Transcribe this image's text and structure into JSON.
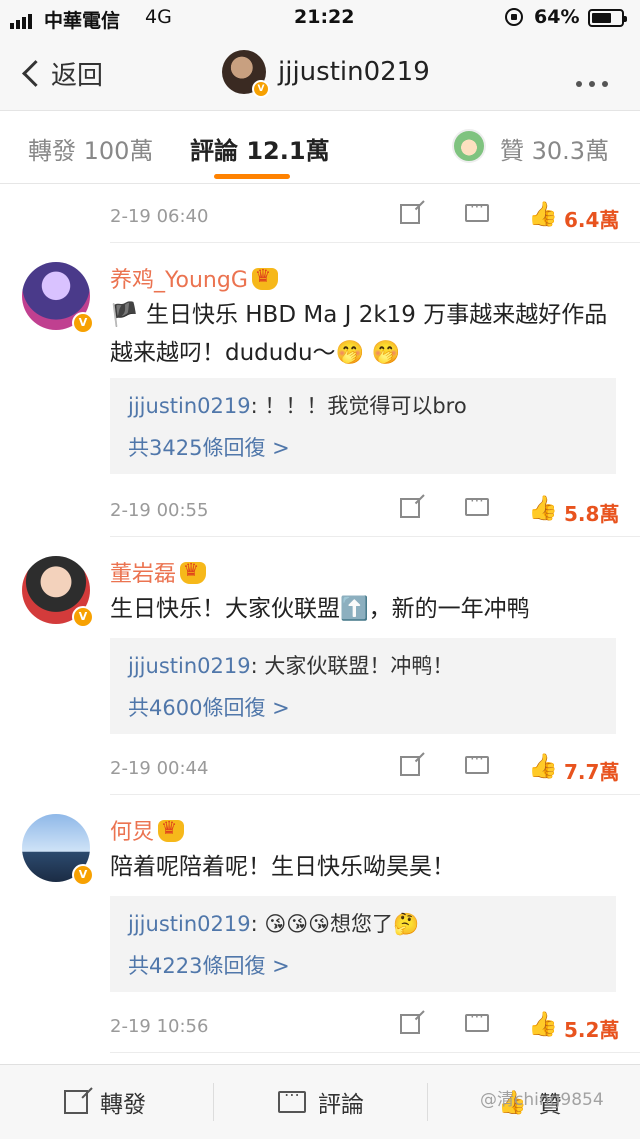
{
  "status_bar": {
    "carrier": "中華電信",
    "network": "4G",
    "time": "21:22",
    "battery": "64%"
  },
  "header": {
    "back_label": "返回",
    "username": "jjjustin0219"
  },
  "tabs": {
    "repost": "轉發 100萬",
    "comments": "評論 12.1萬",
    "likes": "贊 30.3萬"
  },
  "top_meta": {
    "date": "2-19 06:40",
    "likes": "6.4萬"
  },
  "comments": [
    {
      "user": "养鸡_YoungG",
      "text": "🏴 生日快乐 HBD Ma J 2k19 万事越来越好作品越来越叼！dududu～🤭 🤭",
      "reply_user": "jjjustin0219",
      "reply_text": "！！！我觉得可以bro",
      "reply_count": "共3425條回復 >",
      "date": "2-19 00:55",
      "likes": "5.8萬"
    },
    {
      "user": "董岩磊",
      "text": "生日快乐！大家伙联盟⬆️，新的一年冲鸭",
      "reply_user": "jjjustin0219",
      "reply_text": "大家伙联盟！冲鸭！",
      "reply_count": "共4600條回復 >",
      "date": "2-19 00:44",
      "likes": "7.7萬"
    },
    {
      "user": "何炅",
      "text": "陪着呢陪着呢！生日快乐呦昊昊！",
      "reply_user": "jjjustin0219",
      "reply_text": "😘😘😘想您了🤔",
      "reply_count": "共4223條回復 >",
      "date": "2-19 10:56",
      "likes": "5.2萬"
    }
  ],
  "bottom_bar": {
    "repost": "轉發",
    "comment": "評論",
    "like": "贊"
  },
  "watermark": "@清ching9854",
  "colors": {
    "accent": "#ff8200",
    "name": "#eb7350",
    "link": "#5077aa",
    "like": "#e8531e"
  }
}
